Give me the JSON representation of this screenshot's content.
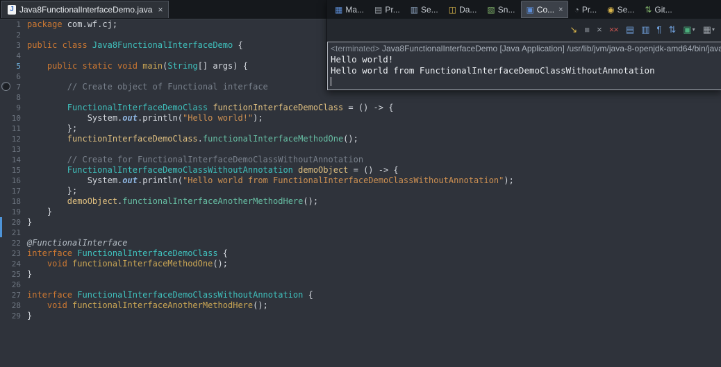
{
  "colors": {
    "editor_bg": "#2F333B",
    "tabstrip_bg": "#15181C",
    "keyword": "#CC7832",
    "type": "#3FC0BC",
    "string": "#CF9152",
    "comment": "#79818C",
    "variable": "#E0C080",
    "method_call": "#67BFA4",
    "selection_bar": "#4E94D8"
  },
  "editor_tab": {
    "icon": "J",
    "title": "Java8FunctionalInterfaceDemo.java",
    "close": "×"
  },
  "editor": {
    "marker_line": 5,
    "lines": [
      {
        "n": 1,
        "s": [
          [
            "package",
            "kw"
          ],
          [
            " com.wf.cj;",
            "pl"
          ]
        ]
      },
      {
        "n": 2,
        "s": []
      },
      {
        "n": 3,
        "s": [
          [
            "public class ",
            "kw"
          ],
          [
            "Java8FunctionalInterfaceDemo",
            "type"
          ],
          [
            " {",
            "pl"
          ]
        ]
      },
      {
        "n": 4,
        "s": []
      },
      {
        "n": 5,
        "s": [
          [
            "    ",
            "pl"
          ],
          [
            "public static void ",
            "kw"
          ],
          [
            "main",
            "mth"
          ],
          [
            "(",
            "pl"
          ],
          [
            "String",
            "type"
          ],
          [
            "[] args) {",
            "pl"
          ]
        ]
      },
      {
        "n": 6,
        "s": []
      },
      {
        "n": 7,
        "s": [
          [
            "        // Create object of Functional interface",
            "cmt"
          ]
        ]
      },
      {
        "n": 8,
        "s": []
      },
      {
        "n": 9,
        "s": [
          [
            "        ",
            "pl"
          ],
          [
            "FunctionalInterfaceDemoClass",
            "type"
          ],
          [
            " ",
            "pl"
          ],
          [
            "functionInterfaceDemoClass",
            "var"
          ],
          [
            " = () -> {",
            "pl"
          ]
        ]
      },
      {
        "n": 10,
        "s": [
          [
            "            System.",
            "pl"
          ],
          [
            "out",
            "fld"
          ],
          [
            ".println(",
            "pl"
          ],
          [
            "\"Hello world!\"",
            "str"
          ],
          [
            ");",
            "pl"
          ]
        ]
      },
      {
        "n": 11,
        "s": [
          [
            "        };",
            "pl"
          ]
        ]
      },
      {
        "n": 12,
        "s": [
          [
            "        ",
            "pl"
          ],
          [
            "functionInterfaceDemoClass",
            "var"
          ],
          [
            ".",
            "pl"
          ],
          [
            "functionalInterfaceMethodOne",
            "call"
          ],
          [
            "();",
            "pl"
          ]
        ]
      },
      {
        "n": 13,
        "s": []
      },
      {
        "n": 14,
        "s": [
          [
            "        // Create for FunctionalInterfaceDemoClassWithoutAnnotation",
            "cmt"
          ]
        ]
      },
      {
        "n": 15,
        "s": [
          [
            "        ",
            "pl"
          ],
          [
            "FunctionalInterfaceDemoClassWithoutAnnotation",
            "type"
          ],
          [
            " ",
            "pl"
          ],
          [
            "demoObject",
            "var"
          ],
          [
            " = () -> {",
            "pl"
          ]
        ]
      },
      {
        "n": 16,
        "s": [
          [
            "            System.",
            "pl"
          ],
          [
            "out",
            "fld"
          ],
          [
            ".println(",
            "pl"
          ],
          [
            "\"Hello world from FunctionalInterfaceDemoClassWithoutAnnotation\"",
            "str"
          ],
          [
            ");",
            "pl"
          ]
        ]
      },
      {
        "n": 17,
        "s": [
          [
            "        };",
            "pl"
          ]
        ]
      },
      {
        "n": 18,
        "s": [
          [
            "        ",
            "pl"
          ],
          [
            "demoObject",
            "var"
          ],
          [
            ".",
            "pl"
          ],
          [
            "functionalInterfaceAnotherMethodHere",
            "call"
          ],
          [
            "();",
            "pl"
          ]
        ]
      },
      {
        "n": 19,
        "s": [
          [
            "    }",
            "pl"
          ]
        ]
      },
      {
        "n": 20,
        "s": [
          [
            "}",
            "pl"
          ]
        ]
      },
      {
        "n": 21,
        "s": []
      },
      {
        "n": 22,
        "s": [
          [
            "@FunctionalInterface",
            "ann"
          ]
        ]
      },
      {
        "n": 23,
        "s": [
          [
            "interface ",
            "kw"
          ],
          [
            "FunctionalInterfaceDemoClass",
            "type"
          ],
          [
            " {",
            "pl"
          ]
        ]
      },
      {
        "n": 24,
        "s": [
          [
            "    ",
            "pl"
          ],
          [
            "void ",
            "kw"
          ],
          [
            "functionalInterfaceMethodOne",
            "mth"
          ],
          [
            "();",
            "pl"
          ]
        ]
      },
      {
        "n": 25,
        "s": [
          [
            "}",
            "pl"
          ]
        ]
      },
      {
        "n": 26,
        "s": []
      },
      {
        "n": 27,
        "s": [
          [
            "interface ",
            "kw"
          ],
          [
            "FunctionalInterfaceDemoClassWithoutAnnotation",
            "type"
          ],
          [
            " {",
            "pl"
          ]
        ]
      },
      {
        "n": 28,
        "s": [
          [
            "    ",
            "pl"
          ],
          [
            "void ",
            "kw"
          ],
          [
            "functionalInterfaceAnotherMethodHere",
            "mth"
          ],
          [
            "();",
            "pl"
          ]
        ]
      },
      {
        "n": 29,
        "s": [
          [
            "}",
            "pl"
          ]
        ]
      }
    ]
  },
  "console": {
    "tabs": [
      {
        "label": "Ma...",
        "icon": "markers-icon",
        "glyph": "▦",
        "color": "#5C8DD6"
      },
      {
        "label": "Pr...",
        "icon": "properties-icon",
        "glyph": "▤",
        "color": "#9AA0A7"
      },
      {
        "label": "Se...",
        "icon": "servers-icon",
        "glyph": "▥",
        "color": "#8FA5C0"
      },
      {
        "label": "Da...",
        "icon": "data-source-explorer-icon",
        "glyph": "◫",
        "color": "#D8B44A"
      },
      {
        "label": "Sn...",
        "icon": "snippets-icon",
        "glyph": "▧",
        "color": "#7FB069"
      },
      {
        "label": "Co...",
        "icon": "console-icon",
        "glyph": "▣",
        "color": "#5C8DD6",
        "active": true,
        "close": "×"
      },
      {
        "label": "Pr...",
        "icon": "progress-icon",
        "glyph": "◔",
        "color": "#9AA0A7"
      },
      {
        "label": "Se...",
        "icon": "search-icon",
        "glyph": "◉",
        "color": "#D8B44A"
      },
      {
        "label": "Git...",
        "icon": "git-staging-icon",
        "glyph": "⇅",
        "color": "#7FB069"
      }
    ],
    "caret_glyph": "▾",
    "toolbar": [
      {
        "name": "show-console-stdout-icon",
        "glyph": "↘",
        "color": "#D8B44A"
      },
      {
        "name": "terminate-icon",
        "glyph": "■",
        "color": "#5F646B"
      },
      {
        "name": "remove-launch-icon",
        "glyph": "×",
        "color": "#9AA0A7"
      },
      {
        "name": "remove-all-terminated-icon",
        "glyph": "××",
        "color": "#C75450"
      },
      {
        "name": "clear-console-icon",
        "glyph": "▤",
        "color": "#6F9ED9"
      },
      {
        "name": "scroll-lock-icon",
        "glyph": "▥",
        "color": "#6F9ED9"
      },
      {
        "name": "word-wrap-icon",
        "glyph": "¶",
        "color": "#6F9ED9"
      },
      {
        "name": "pin-console-icon",
        "glyph": "⇅",
        "color": "#6F9ED9"
      },
      {
        "name": "display-selected-console-icon",
        "glyph": "▣",
        "color": "#4CAF7D",
        "caret": true
      },
      {
        "name": "open-console-icon",
        "glyph": "▦",
        "color": "#9AA0A7",
        "caret": true
      }
    ],
    "status_prefix": "<terminated>",
    "status_rest": " Java8FunctionalInterfaceDemo [Java Application] /usr/lib/jvm/java-8-openjdk-amd64/bin/java",
    "output": [
      "Hello world!",
      "Hello world from FunctionalInterfaceDemoClassWithoutAnnotation"
    ]
  }
}
